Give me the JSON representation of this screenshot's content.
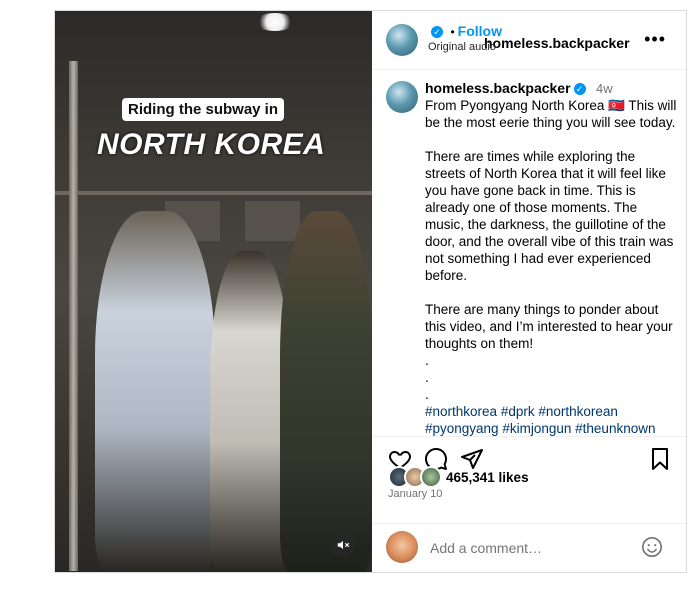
{
  "media": {
    "caption_line1": "Riding the subway in",
    "caption_line2": "NORTH KOREA"
  },
  "header": {
    "username": "homeless.backpacker",
    "follow_label": "Follow",
    "separator": "•",
    "audio": "Original audio"
  },
  "post": {
    "username": "homeless.backpacker",
    "time": "4w",
    "paragraph1": "From Pyongyang North Korea 🇰🇵 This will be the most eerie thing you will see today.",
    "paragraph2": "There are times while exploring the streets of North Korea that it will feel like you have gone back in time. This is already one of those moments. The music, the darkness, the guillotine of the door, and the overall vibe of this train was not something I had ever experienced before.",
    "paragraph3": "There are many things to ponder about this video, and I’m interested to hear your thoughts on them!",
    "dots": [
      ".",
      ".",
      "."
    ],
    "hashtags_line1": [
      "#northkorea",
      "#dprk",
      "#northkorean"
    ],
    "hashtags_line2": [
      "#pyongyang",
      "#kimjongun",
      "#theunknown"
    ]
  },
  "engagement": {
    "likes": "465,341 likes",
    "date": "January 10"
  },
  "comment": {
    "placeholder": "Add a comment…"
  },
  "colors": {
    "link_blue": "#0095f6",
    "hashtag": "#00376b",
    "muted": "#737373"
  }
}
